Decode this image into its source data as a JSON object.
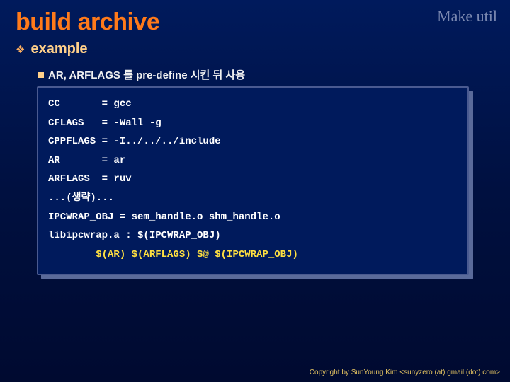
{
  "header_label": "Make util",
  "title": "build archive",
  "lvl1": {
    "bullet": "❖",
    "text": "example"
  },
  "lvl2": {
    "text": "AR, ARFLAGS 를 pre-define 시킨 뒤 사용"
  },
  "code": {
    "r1": "CC       = gcc",
    "r2": "CFLAGS   = -Wall -g",
    "r3": "CPPFLAGS = -I../../../include",
    "r4": "AR       = ar",
    "r5": "ARFLAGS  = ruv",
    "r6": "...(생략)...",
    "r7": "IPCWRAP_OBJ = sem_handle.o shm_handle.o",
    "r8": "libipcwrap.a : $(IPCWRAP_OBJ)",
    "r9_in": "        ",
    "r9_y": "$(AR) $(ARFLAGS) $@ $(IPCWRAP_OBJ)"
  },
  "footer": "Copyright by SunYoung Kim <sunyzero (at) gmail (dot) com>"
}
